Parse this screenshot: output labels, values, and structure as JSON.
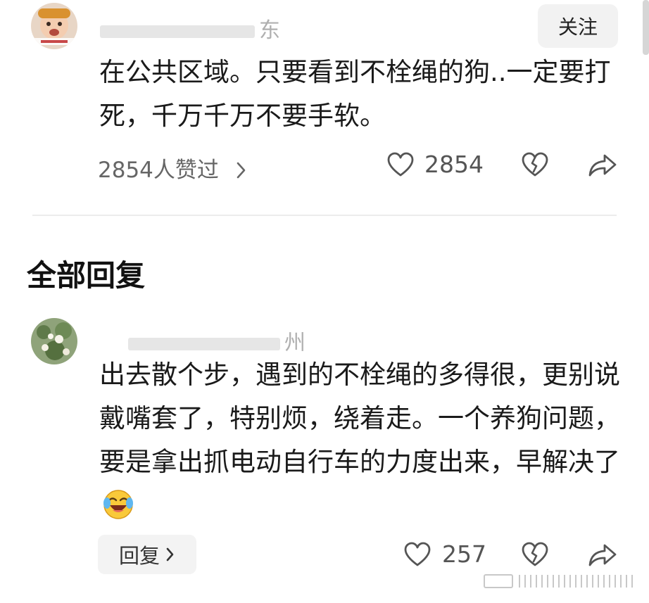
{
  "top_comment": {
    "username_suffix": "东",
    "follow_label": "关注",
    "text": "在公共区域。只要看到不栓绳的狗..一定要打死，千万千万不要手软。",
    "liked_by": "2854人赞过",
    "like_count": "2854"
  },
  "section_title": "全部回复",
  "reply": {
    "username_suffix": "州",
    "text": "出去散个步，遇到的不栓绳的多得很，更别说戴嘴套了，特别烦，绕着走。一个养狗问题，要是拿出抓电动自行车的力度出来，早解决了",
    "reply_label": "回复",
    "like_count": "257"
  },
  "icons": {
    "like": "heart-outline-icon",
    "dislike": "broken-heart-icon",
    "share": "share-arrow-icon",
    "chevron": "chevron-right-icon",
    "emoji": "laughing-crying-emoji-icon"
  },
  "colors": {
    "text": "#1a1a1a",
    "muted": "#666666",
    "button_bg": "#f2f2f2",
    "divider": "#ececec"
  }
}
